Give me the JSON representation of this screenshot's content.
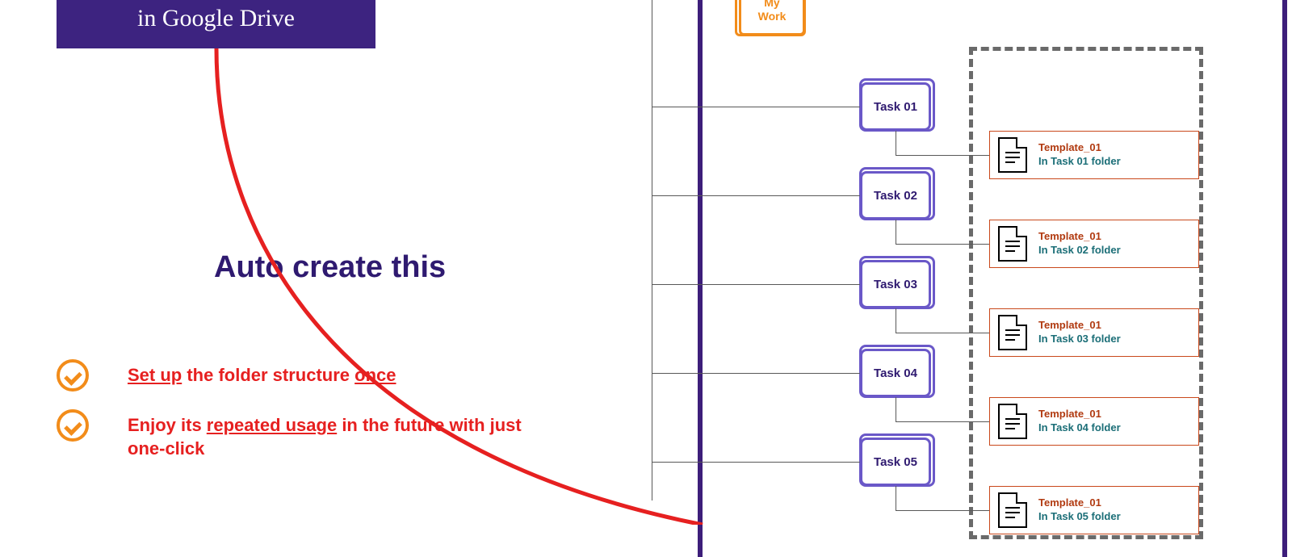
{
  "title_box": {
    "text": "in Google Drive"
  },
  "middle_heading": "Auto create this",
  "bullets": [
    {
      "prefix": "Set up",
      "mid": " the folder structure ",
      "suffix": "once",
      "rest": ""
    },
    {
      "prefix": "",
      "mid": "Enjoy its ",
      "suffix": "repeated usage",
      "rest": " in the future with just one-click"
    }
  ],
  "root_folder": {
    "line1": "My",
    "line2": "Work"
  },
  "tasks": [
    {
      "label": "Task 01"
    },
    {
      "label": "Task 02"
    },
    {
      "label": "Task 03"
    },
    {
      "label": "Task 04"
    },
    {
      "label": "Task 05"
    }
  ],
  "templates": [
    {
      "name": "Template_01",
      "sub": "In Task 01 folder"
    },
    {
      "name": "Template_01",
      "sub": "In Task 02 folder"
    },
    {
      "name": "Template_01",
      "sub": "In Task 03 folder"
    },
    {
      "name": "Template_01",
      "sub": "In Task 04 folder"
    },
    {
      "name": "Template_01",
      "sub": "In Task 05 folder"
    }
  ]
}
